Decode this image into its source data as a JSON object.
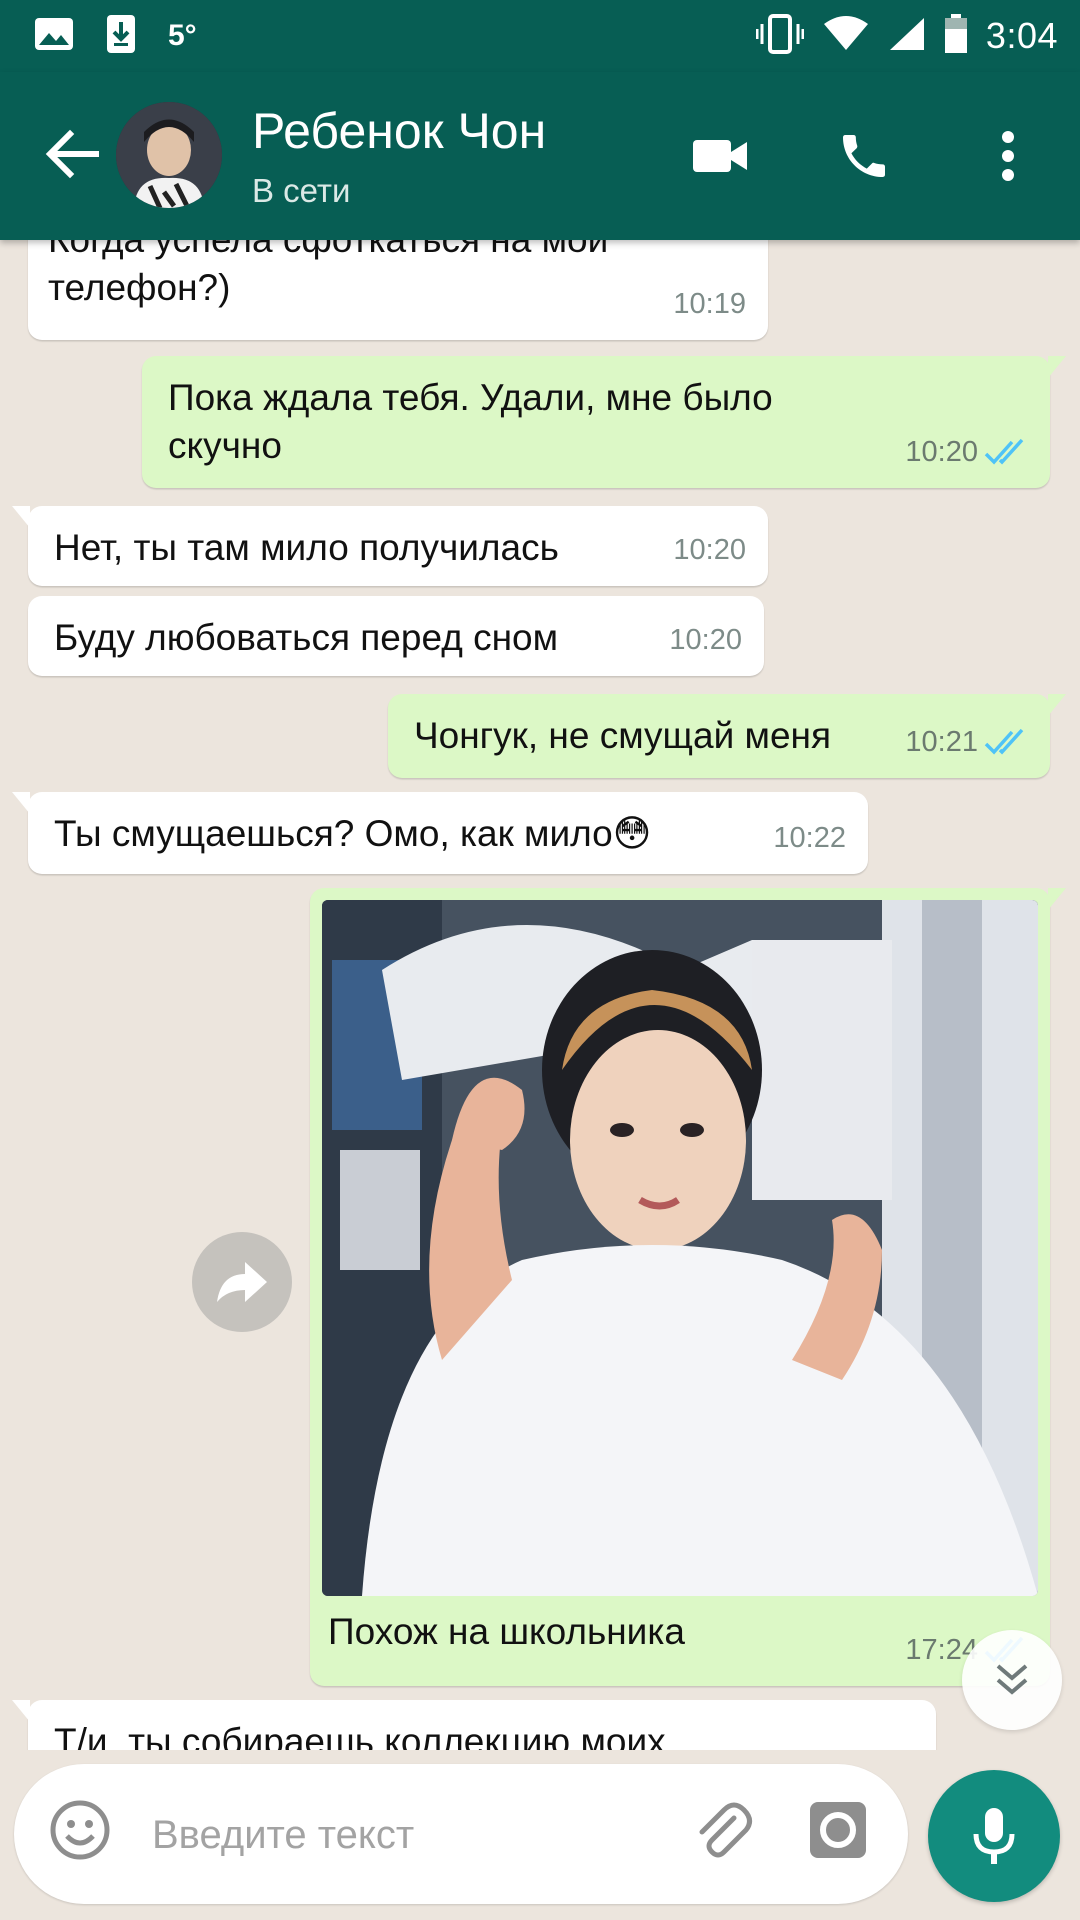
{
  "status_bar": {
    "temperature": "5°",
    "time": "3:04"
  },
  "header": {
    "back_icon": "arrow-left-icon",
    "contact_name": "Ребенок Чон",
    "contact_status": "В сети",
    "video_icon": "video-camera-icon",
    "call_icon": "phone-icon",
    "menu_icon": "more-vertical-icon"
  },
  "messages": [
    {
      "direction": "in",
      "text": "Когда успела сфоткаться на мой\nтелефон?)",
      "time": "10:19"
    },
    {
      "direction": "out",
      "text": "Пока ждала тебя. Удали, мне было\nскучно",
      "time": "10:20",
      "status": "read"
    },
    {
      "direction": "in",
      "text": "Нет, ты там мило получилась",
      "time": "10:20"
    },
    {
      "direction": "in",
      "text": "Буду любоваться перед сном",
      "time": "10:20"
    },
    {
      "direction": "out",
      "text": "Чонгук, не смущай меня",
      "time": "10:21",
      "status": "read"
    },
    {
      "direction": "in",
      "text": "Ты смущаешься? Омо, как мило😳",
      "time": "10:22"
    },
    {
      "direction": "out",
      "type": "image",
      "caption": "Похож на школьника",
      "time": "17:24",
      "status": "read"
    },
    {
      "direction": "in",
      "text": "Т/и, ты собираешь коллекцию моих",
      "time": ""
    }
  ],
  "input": {
    "placeholder": "Введите текст",
    "value": ""
  },
  "colors": {
    "header": "#075e54",
    "outgoing_bubble": "#dcf8c6",
    "incoming_bubble": "#ffffff",
    "read_ticks": "#4fc3f7",
    "mic_button": "#128c7e"
  }
}
